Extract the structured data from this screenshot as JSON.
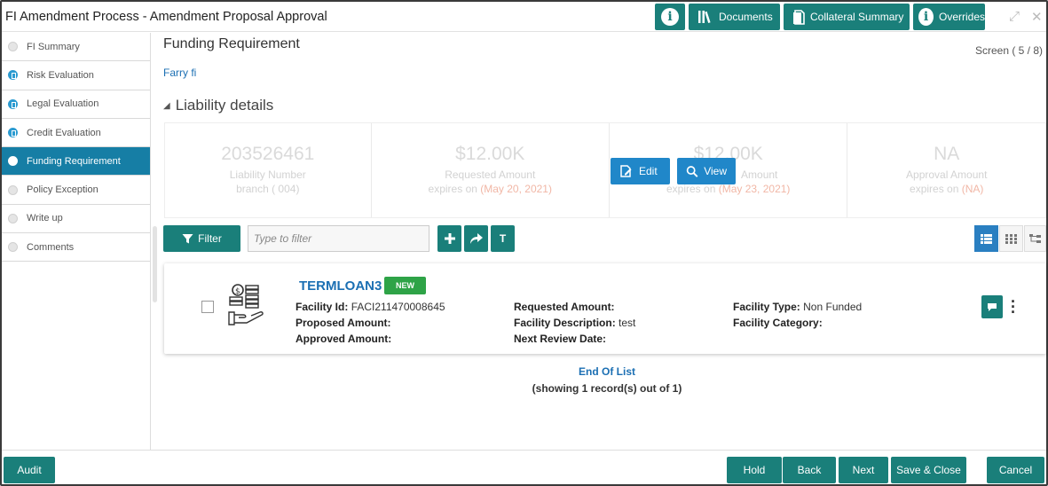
{
  "window": {
    "title": "FI Amendment Process - Amendment Proposal Approval",
    "buttons": {
      "info_icon": "info-icon",
      "documents": "Documents",
      "collateral_summary": "Collateral Summary",
      "overrides": "Overrides"
    }
  },
  "sidebar": {
    "items": [
      {
        "label": "FI Summary",
        "state": "pending"
      },
      {
        "label": "Risk Evaluation",
        "state": "done"
      },
      {
        "label": "Legal Evaluation",
        "state": "done"
      },
      {
        "label": "Credit Evaluation",
        "state": "done"
      },
      {
        "label": "Funding Requirement",
        "state": "active"
      },
      {
        "label": "Policy Exception",
        "state": "pending"
      },
      {
        "label": "Write up",
        "state": "pending"
      },
      {
        "label": "Comments",
        "state": "pending"
      }
    ]
  },
  "main": {
    "title": "Funding Requirement",
    "screen": "Screen ( 5 / 8)",
    "sub_link": "Farry fi",
    "section_title": "Liability details",
    "cards": [
      {
        "big": "203526461",
        "label": "Liability Number",
        "line2": "branch ( 004)"
      },
      {
        "big": "$12.00K",
        "label": "Requested Amount",
        "exp_prefix": "expires on ",
        "exp_date": "(May 20, 2021)"
      },
      {
        "big": "$12.00K",
        "label": "Amount",
        "exp_prefix": "expires on ",
        "exp_date": "(May 23, 2021)"
      },
      {
        "big": "NA",
        "label": "Approval Amount",
        "exp_prefix": "expires on ",
        "exp_date": "(NA)"
      }
    ],
    "hover_buttons": {
      "edit": "Edit",
      "view": "View"
    },
    "toolbar": {
      "filter_label": "Filter",
      "filter_placeholder": "Type to filter",
      "add": "+",
      "t": "T"
    },
    "record": {
      "name": "TERMLOAN3",
      "badge": "NEW",
      "facility_id_key": "Facility Id:",
      "facility_id": "FACI211470008645",
      "proposed_amount_key": "Proposed Amount:",
      "approved_amount_key": "Approved Amount:",
      "requested_amount_key": "Requested Amount:",
      "facility_description_key": "Facility Description:",
      "facility_description": "test",
      "next_review_key": "Next Review Date:",
      "facility_type_key": "Facility Type:",
      "facility_type": "Non Funded",
      "facility_category_key": "Facility Category:"
    },
    "end_of_list": "End Of List",
    "showing": "(showing 1 record(s) out of 1)"
  },
  "footer": {
    "audit": "Audit",
    "hold": "Hold",
    "back": "Back",
    "next": "Next",
    "save_close": "Save & Close",
    "cancel": "Cancel"
  },
  "colors": {
    "teal": "#1a7f7a",
    "blue_active": "#167ea5",
    "link_blue": "#1b6fb3",
    "badge_green": "#2ea347"
  }
}
